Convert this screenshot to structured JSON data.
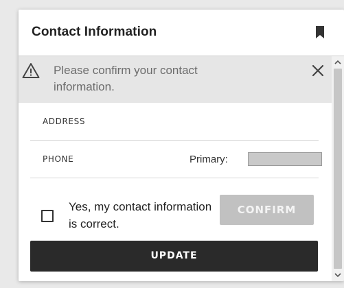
{
  "card": {
    "title": "Contact Information",
    "header_icon": "bookmark-icon"
  },
  "alert": {
    "icon": "warning-icon",
    "message": "Please confirm your contact information.",
    "close_icon": "close-icon"
  },
  "fields": {
    "address_label": "ADDRESS",
    "phone_label": "PHONE",
    "primary_label": "Primary:",
    "primary_value": ""
  },
  "confirmation": {
    "checkbox_checked": false,
    "checkbox_label": "Yes, my contact information is correct.",
    "confirm_label": "CONFIRM",
    "confirm_disabled": true
  },
  "actions": {
    "update_label": "UPDATE"
  },
  "scrollbar": {
    "up_icon": "chevron-up-icon",
    "down_icon": "chevron-down-icon"
  },
  "colors": {
    "alert_bg": "#e6e6e6",
    "update_bg": "#2a2a2a",
    "confirm_disabled_bg": "#c1c1c1"
  }
}
